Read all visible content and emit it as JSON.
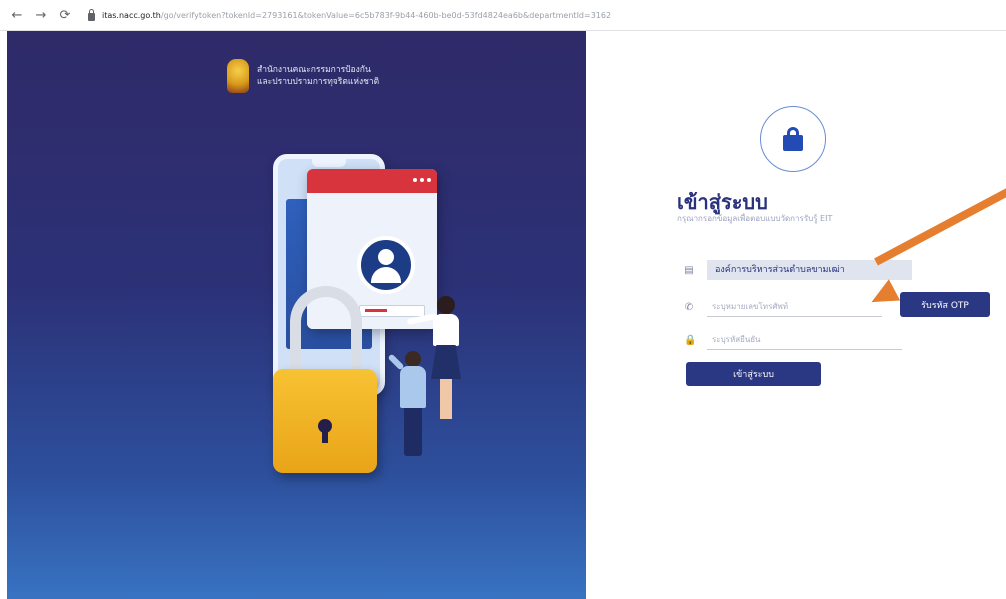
{
  "browser": {
    "back_glyph": "←",
    "forward_glyph": "→",
    "reload_glyph": "⟳",
    "url_host": "itas.nacc.go.th",
    "url_path": "/go/verifytoken?tokenId=2793161&tokenValue=6c5b783f-9b44-460b-be0d-53fd4824ea6b&departmentId=3162"
  },
  "organization": {
    "name_line1": "สำนักงานคณะกรรมการป้องกัน",
    "name_line2": "และปราบปรามการทุจริตแห่งชาติ"
  },
  "login": {
    "title": "เข้าสู่ระบบ",
    "subtitle": "กรุณากรอกข้อมูลเพื่อตอบแบบวัดการรับรู้ EIT",
    "org_value": "องค์การบริหารส่วนตำบลขามเฒ่า",
    "phone_placeholder": "ระบุหมายเลขโทรศัพท์",
    "otp_placeholder": "ระบุรหัสยืนยัน",
    "otp_button": "รับรหัส OTP",
    "login_button": "เข้าสู่ระบบ"
  },
  "colors": {
    "primary": "#2a3783",
    "annotation_arrow": "#e57e2e"
  },
  "icons": {
    "org_field": "building-icon",
    "phone_field": "phone-icon",
    "otp_field": "lock-icon",
    "hero": "lock-icon"
  }
}
